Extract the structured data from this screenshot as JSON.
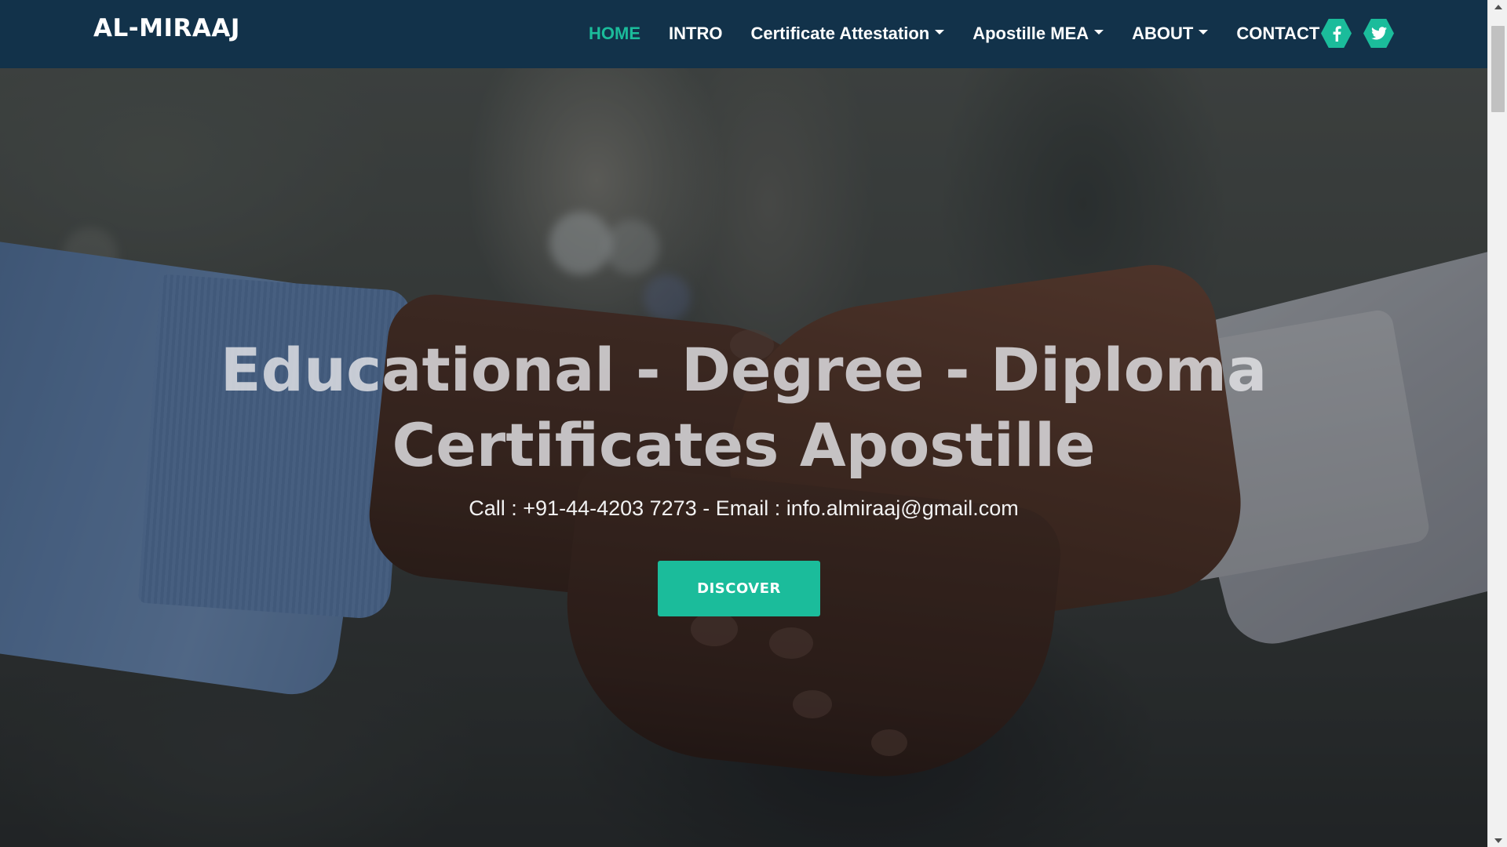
{
  "navbar": {
    "brand": "AL-MIRAAJ",
    "items": [
      {
        "label": "HOME",
        "active": true,
        "dropdown": false
      },
      {
        "label": "INTRO",
        "active": false,
        "dropdown": false
      },
      {
        "label": "Certificate Attestation",
        "active": false,
        "dropdown": true
      },
      {
        "label": "Apostille MEA",
        "active": false,
        "dropdown": true
      },
      {
        "label": "ABOUT",
        "active": false,
        "dropdown": true
      },
      {
        "label": "CONTACT",
        "active": false,
        "dropdown": false
      }
    ],
    "social": [
      {
        "icon": "facebook-icon"
      },
      {
        "icon": "twitter-icon"
      }
    ]
  },
  "hero": {
    "title_line1": "Educational - Degree - Diploma",
    "title_line2": "Certificates Apostille",
    "subtitle": "Call : +91-44-4203 7273 - Email : info.almiraaj@gmail.com",
    "cta_label": "DISCOVER",
    "background_image": "handshake photo"
  },
  "colors": {
    "navbar_bg": "#12324a",
    "accent": "#1bbc9b",
    "nav_text": "#ffffff"
  }
}
